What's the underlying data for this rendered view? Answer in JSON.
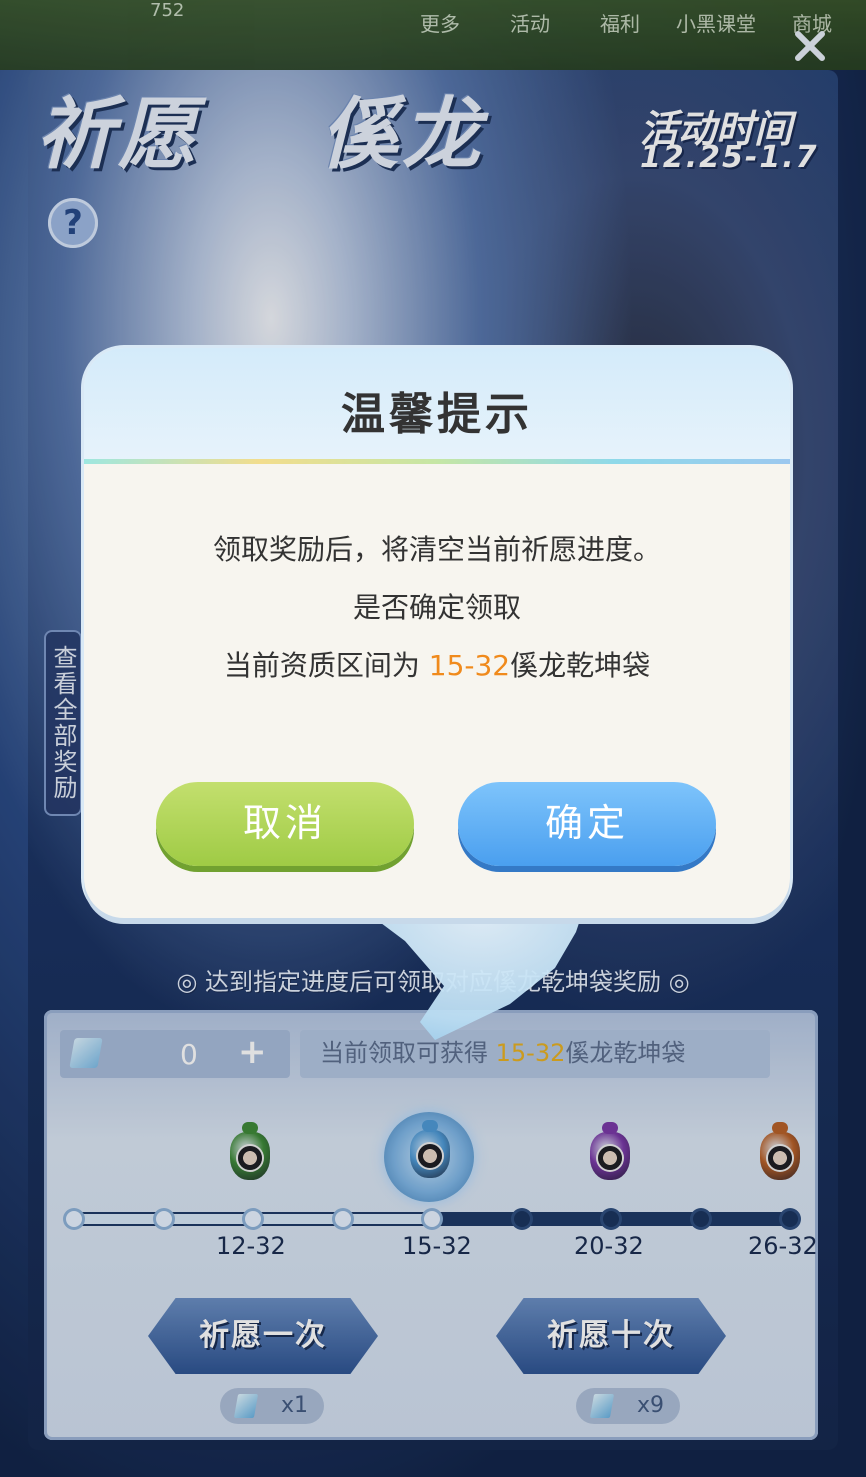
{
  "top_nav": {
    "counter": "752",
    "items": [
      "更多",
      "活动",
      "福利",
      "小黑课堂",
      "商城"
    ]
  },
  "banner": {
    "title_part1": "祈愿",
    "title_part2": "傒龙",
    "event_label": "活动时间",
    "event_dates": "12.25-1.7"
  },
  "help_icon": "question-mark",
  "view_all_rewards": "查看全部奖励",
  "hint_line": "◎ 达到指定进度后可领取对应傒龙乾坤袋奖励 ◎",
  "currency": {
    "count": "0",
    "plus": "+"
  },
  "claim_info": {
    "prefix": "当前领取可获得 ",
    "range": "15-32",
    "suffix": "傒龙乾坤袋"
  },
  "progress": {
    "fill_fraction": 0.5,
    "nodes_total": 9,
    "nodes_filled": 5,
    "tiers": [
      {
        "label": "12-32",
        "bag_color": "#3f8a3a"
      },
      {
        "label": "15-32",
        "bag_color": "#4f9ad6"
      },
      {
        "label": "20-32",
        "bag_color": "#7a3aa8"
      },
      {
        "label": "26-32",
        "bag_color": "#b8612a"
      }
    ]
  },
  "wish_once": {
    "label": "祈愿一次",
    "cost": "x1"
  },
  "wish_ten": {
    "label": "祈愿十次",
    "cost": "x9"
  },
  "modal": {
    "title": "温馨提示",
    "line1": "领取奖励后，将清空当前祈愿进度。",
    "line2": "是否确定领取",
    "line3_prefix": "当前资质区间为 ",
    "line3_range": "15-32",
    "line3_suffix": "傒龙乾坤袋",
    "cancel_label": "取消",
    "confirm_label": "确定"
  },
  "colors": {
    "accent_orange": "#f08a1c",
    "accent_yellow": "#e7b123",
    "cancel_green": "#9fcb45",
    "confirm_blue": "#4a9fef"
  }
}
